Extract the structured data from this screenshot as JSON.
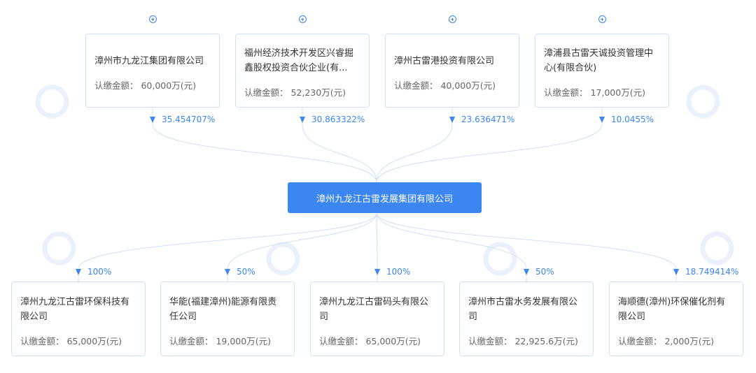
{
  "center": {
    "name": "漳州九龙江古雷发展集团有限公司"
  },
  "amount_label": "认缴金额：",
  "shareholders": [
    {
      "name": "漳州市九龙江集团有限公司",
      "amount": "60,000万(元)",
      "percent": "35.454707%"
    },
    {
      "name": "福州经济技术开发区兴睿掘鑫股权投资合伙企业(有...",
      "amount": "52,230万(元)",
      "percent": "30.863322%"
    },
    {
      "name": "漳州古雷港投资有限公司",
      "amount": "40,000万(元)",
      "percent": "23.636471%"
    },
    {
      "name": "漳浦县古雷天诚投资管理中心(有限合伙)",
      "amount": "17,000万(元)",
      "percent": "10.0455%"
    }
  ],
  "investments": [
    {
      "name": "漳州九龙江古雷环保科技有限公司",
      "amount": "65,000万(元)",
      "percent": "100%"
    },
    {
      "name": "华能(福建漳州)能源有限责任公司",
      "amount": "19,000万(元)",
      "percent": "50%"
    },
    {
      "name": "漳州九龙江古雷码头有限公司",
      "amount": "65,000万(元)",
      "percent": "100%"
    },
    {
      "name": "漳州市古雷水务发展有限公司",
      "amount": "22,925.6万(元)",
      "percent": "50%"
    },
    {
      "name": "海顺德(漳州)环保催化剂有限公司",
      "amount": "2,000万(元)",
      "percent": "18.749414%"
    }
  ],
  "colors": {
    "accent": "#3b86f0",
    "line": "#cfe0f7",
    "card_border": "#cfe0f7"
  },
  "icons": {
    "expand": "plus-circle-icon",
    "arrow": "arrow-down-icon"
  }
}
